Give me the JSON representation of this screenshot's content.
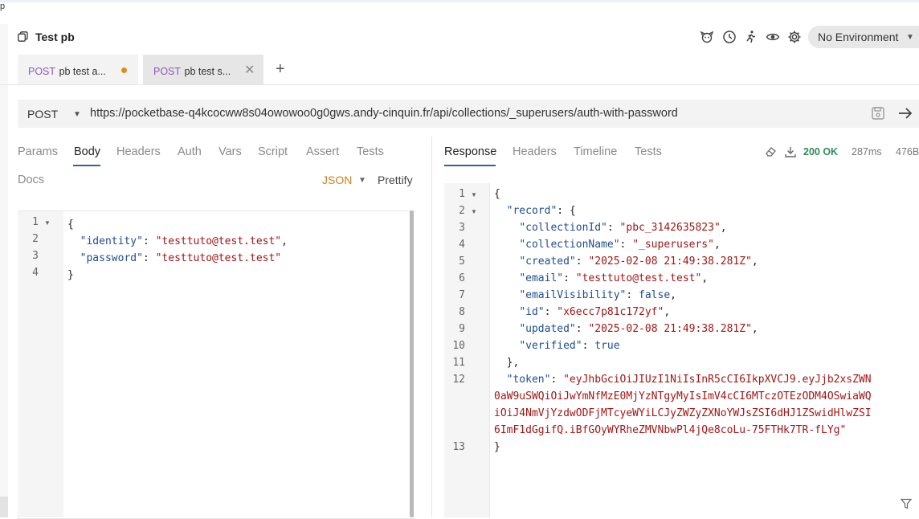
{
  "corner_char": "p",
  "workspace": {
    "title": "Test pb"
  },
  "environment": {
    "label": "No Environment"
  },
  "tabs": [
    {
      "method": "POST",
      "name": "pb test a...",
      "modified": true
    },
    {
      "method": "POST",
      "name": "pb test s...",
      "closable": true
    }
  ],
  "request": {
    "method": "POST",
    "url": "https://pocketbase-q4kcocww8s04owowoo0g0gws.andy-cinquin.fr/api/collections/_superusers/auth-with-password",
    "tabs": [
      "Params",
      "Body",
      "Headers",
      "Auth",
      "Vars",
      "Script",
      "Assert",
      "Tests",
      "Docs"
    ],
    "active_tab": "Body",
    "body_mode": "JSON",
    "prettify_label": "Prettify",
    "body_lines": [
      "{",
      "  \"identity\": \"testtuto@test.test\",",
      "  \"password\": \"testtuto@test.test\"",
      "}"
    ]
  },
  "response": {
    "tabs": [
      "Response",
      "Headers",
      "Timeline",
      "Tests"
    ],
    "active_tab": "Response",
    "status": "200 OK",
    "time": "287ms",
    "size": "476B",
    "lines": [
      {
        "n": "1",
        "text": "{"
      },
      {
        "n": "2",
        "text": "  \"record\": {"
      },
      {
        "n": "3",
        "text": "    \"collectionId\": \"pbc_3142635823\","
      },
      {
        "n": "4",
        "text": "    \"collectionName\": \"_superusers\","
      },
      {
        "n": "5",
        "text": "    \"created\": \"2025-02-08 21:49:38.281Z\","
      },
      {
        "n": "6",
        "text": "    \"email\": \"testtuto@test.test\","
      },
      {
        "n": "7",
        "text": "    \"emailVisibility\": false,"
      },
      {
        "n": "8",
        "text": "    \"id\": \"x6ecc7p81c172yf\","
      },
      {
        "n": "9",
        "text": "    \"updated\": \"2025-02-08 21:49:38.281Z\","
      },
      {
        "n": "10",
        "text": "    \"verified\": true"
      },
      {
        "n": "11",
        "text": "  },"
      },
      {
        "n": "12",
        "text": "  \"token\": \"eyJhbGciOiJIUzI1NiIsInR5cCI6IkpXVCJ9.eyJjb2xsZWN"
      },
      {
        "n": "",
        "text": "0aW9uSWQiOiJwYmNfMzE0MjYzNTgyMyIsImV4cCI6MTczOTEzODM4OSwiaWQ"
      },
      {
        "n": "",
        "text": "iOiJ4NmVjYzdwODFjMTcyeWYiLCJyZWZyZXNoYWJsZSI6dHJ1ZSwidHlwZSI"
      },
      {
        "n": "",
        "text": "6ImF1dGgifQ.iBfGOyWYRheZMVNbwPl4jQe8coLu-75FTHk7TR-fLYg\""
      },
      {
        "n": "13",
        "text": "}"
      }
    ]
  },
  "colors": {
    "accent": "#3d5aa8",
    "method": "#8c5bb5",
    "status_ok": "#2c8c5a",
    "modified_dot": "#e18b1b"
  }
}
